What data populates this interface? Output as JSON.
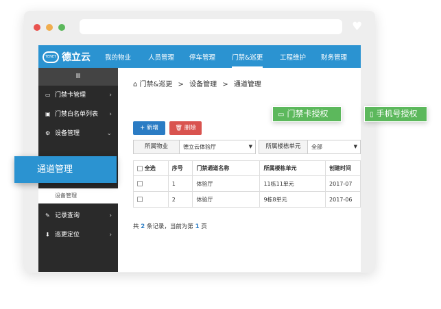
{
  "browser": {
    "dots": [
      "#e9534f",
      "#f0ad4e",
      "#5cb85c"
    ]
  },
  "app": {
    "logo_text": "德立云",
    "logo_small": "TENET"
  },
  "nav": {
    "items": [
      {
        "label": "我的物业"
      },
      {
        "label": "人员管理"
      },
      {
        "label": "停车管理"
      },
      {
        "label": "门禁&巡更",
        "active": true
      },
      {
        "label": "工程维护"
      },
      {
        "label": "财务管理"
      }
    ]
  },
  "sidebar": {
    "toggle": "Ⅲ",
    "items": [
      {
        "label": "门禁卡管理",
        "icon": "card-icon"
      },
      {
        "label": "门禁白名单列表",
        "icon": "id-card-icon"
      },
      {
        "label": "设备管理",
        "icon": "gears-icon",
        "expanded": true
      },
      {
        "label": "记录查询",
        "icon": "edit-icon"
      },
      {
        "label": "巡更定位",
        "icon": "location-pin-icon"
      }
    ],
    "sub_items": [
      "设备管理"
    ]
  },
  "breadcrumb": {
    "home_icon": "home-icon",
    "parts": [
      "门禁&巡更",
      "设备管理",
      "通道管理"
    ],
    "separator": ">"
  },
  "toolbar": {
    "add_label": "+ 新增",
    "delete_label": "删除",
    "add_color": "#2b7cc4",
    "delete_color": "#d9534f"
  },
  "filters": {
    "property_label": "所属物业",
    "property_value": "德立云体验厅",
    "unit_label": "所属楼栋单元",
    "unit_value": "全部"
  },
  "table": {
    "columns": [
      "全选",
      "序号",
      "门禁通道名称",
      "所属楼栋单元",
      "创建时间"
    ],
    "rows": [
      {
        "index": "1",
        "name": "体验厅",
        "unit": "11栋11单元",
        "created": "2017-07"
      },
      {
        "index": "2",
        "name": "体验厅",
        "unit": "9栋8单元",
        "created": "2017-06"
      }
    ]
  },
  "pager": {
    "prefix": "共",
    "total": "2",
    "middle": "条记录，当前为第",
    "page": "1",
    "suffix": "页"
  },
  "callout": {
    "label": "通道管理"
  },
  "tags": {
    "card_auth": {
      "label": "门禁卡授权",
      "icon": "card-icon"
    },
    "phone_auth": {
      "label": "手机号授权",
      "icon": "phone-icon"
    },
    "color": "#5cb85c"
  }
}
